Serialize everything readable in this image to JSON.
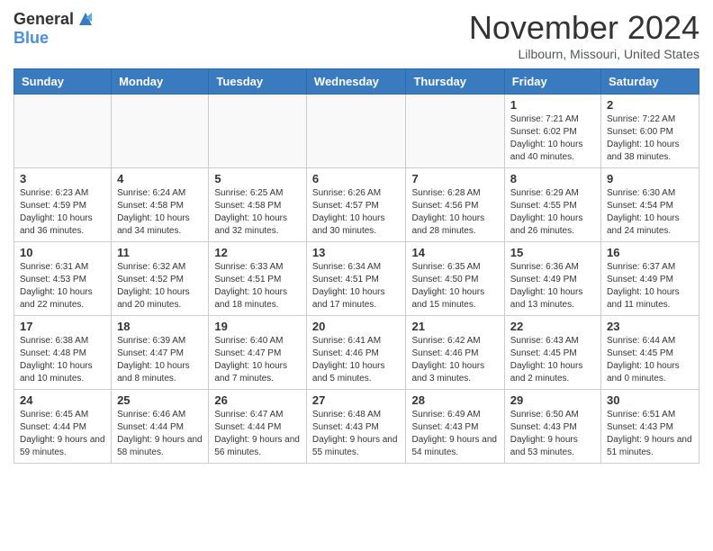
{
  "header": {
    "logo_general": "General",
    "logo_blue": "Blue",
    "month_title": "November 2024",
    "location": "Lilbourn, Missouri, United States"
  },
  "days_of_week": [
    "Sunday",
    "Monday",
    "Tuesday",
    "Wednesday",
    "Thursday",
    "Friday",
    "Saturday"
  ],
  "weeks": [
    [
      {
        "day": "",
        "info": ""
      },
      {
        "day": "",
        "info": ""
      },
      {
        "day": "",
        "info": ""
      },
      {
        "day": "",
        "info": ""
      },
      {
        "day": "",
        "info": ""
      },
      {
        "day": "1",
        "info": "Sunrise: 7:21 AM\nSunset: 6:02 PM\nDaylight: 10 hours and 40 minutes."
      },
      {
        "day": "2",
        "info": "Sunrise: 7:22 AM\nSunset: 6:00 PM\nDaylight: 10 hours and 38 minutes."
      }
    ],
    [
      {
        "day": "3",
        "info": "Sunrise: 6:23 AM\nSunset: 4:59 PM\nDaylight: 10 hours and 36 minutes."
      },
      {
        "day": "4",
        "info": "Sunrise: 6:24 AM\nSunset: 4:58 PM\nDaylight: 10 hours and 34 minutes."
      },
      {
        "day": "5",
        "info": "Sunrise: 6:25 AM\nSunset: 4:58 PM\nDaylight: 10 hours and 32 minutes."
      },
      {
        "day": "6",
        "info": "Sunrise: 6:26 AM\nSunset: 4:57 PM\nDaylight: 10 hours and 30 minutes."
      },
      {
        "day": "7",
        "info": "Sunrise: 6:28 AM\nSunset: 4:56 PM\nDaylight: 10 hours and 28 minutes."
      },
      {
        "day": "8",
        "info": "Sunrise: 6:29 AM\nSunset: 4:55 PM\nDaylight: 10 hours and 26 minutes."
      },
      {
        "day": "9",
        "info": "Sunrise: 6:30 AM\nSunset: 4:54 PM\nDaylight: 10 hours and 24 minutes."
      }
    ],
    [
      {
        "day": "10",
        "info": "Sunrise: 6:31 AM\nSunset: 4:53 PM\nDaylight: 10 hours and 22 minutes."
      },
      {
        "day": "11",
        "info": "Sunrise: 6:32 AM\nSunset: 4:52 PM\nDaylight: 10 hours and 20 minutes."
      },
      {
        "day": "12",
        "info": "Sunrise: 6:33 AM\nSunset: 4:51 PM\nDaylight: 10 hours and 18 minutes."
      },
      {
        "day": "13",
        "info": "Sunrise: 6:34 AM\nSunset: 4:51 PM\nDaylight: 10 hours and 17 minutes."
      },
      {
        "day": "14",
        "info": "Sunrise: 6:35 AM\nSunset: 4:50 PM\nDaylight: 10 hours and 15 minutes."
      },
      {
        "day": "15",
        "info": "Sunrise: 6:36 AM\nSunset: 4:49 PM\nDaylight: 10 hours and 13 minutes."
      },
      {
        "day": "16",
        "info": "Sunrise: 6:37 AM\nSunset: 4:49 PM\nDaylight: 10 hours and 11 minutes."
      }
    ],
    [
      {
        "day": "17",
        "info": "Sunrise: 6:38 AM\nSunset: 4:48 PM\nDaylight: 10 hours and 10 minutes."
      },
      {
        "day": "18",
        "info": "Sunrise: 6:39 AM\nSunset: 4:47 PM\nDaylight: 10 hours and 8 minutes."
      },
      {
        "day": "19",
        "info": "Sunrise: 6:40 AM\nSunset: 4:47 PM\nDaylight: 10 hours and 7 minutes."
      },
      {
        "day": "20",
        "info": "Sunrise: 6:41 AM\nSunset: 4:46 PM\nDaylight: 10 hours and 5 minutes."
      },
      {
        "day": "21",
        "info": "Sunrise: 6:42 AM\nSunset: 4:46 PM\nDaylight: 10 hours and 3 minutes."
      },
      {
        "day": "22",
        "info": "Sunrise: 6:43 AM\nSunset: 4:45 PM\nDaylight: 10 hours and 2 minutes."
      },
      {
        "day": "23",
        "info": "Sunrise: 6:44 AM\nSunset: 4:45 PM\nDaylight: 10 hours and 0 minutes."
      }
    ],
    [
      {
        "day": "24",
        "info": "Sunrise: 6:45 AM\nSunset: 4:44 PM\nDaylight: 9 hours and 59 minutes."
      },
      {
        "day": "25",
        "info": "Sunrise: 6:46 AM\nSunset: 4:44 PM\nDaylight: 9 hours and 58 minutes."
      },
      {
        "day": "26",
        "info": "Sunrise: 6:47 AM\nSunset: 4:44 PM\nDaylight: 9 hours and 56 minutes."
      },
      {
        "day": "27",
        "info": "Sunrise: 6:48 AM\nSunset: 4:43 PM\nDaylight: 9 hours and 55 minutes."
      },
      {
        "day": "28",
        "info": "Sunrise: 6:49 AM\nSunset: 4:43 PM\nDaylight: 9 hours and 54 minutes."
      },
      {
        "day": "29",
        "info": "Sunrise: 6:50 AM\nSunset: 4:43 PM\nDaylight: 9 hours and 53 minutes."
      },
      {
        "day": "30",
        "info": "Sunrise: 6:51 AM\nSunset: 4:43 PM\nDaylight: 9 hours and 51 minutes."
      }
    ]
  ]
}
